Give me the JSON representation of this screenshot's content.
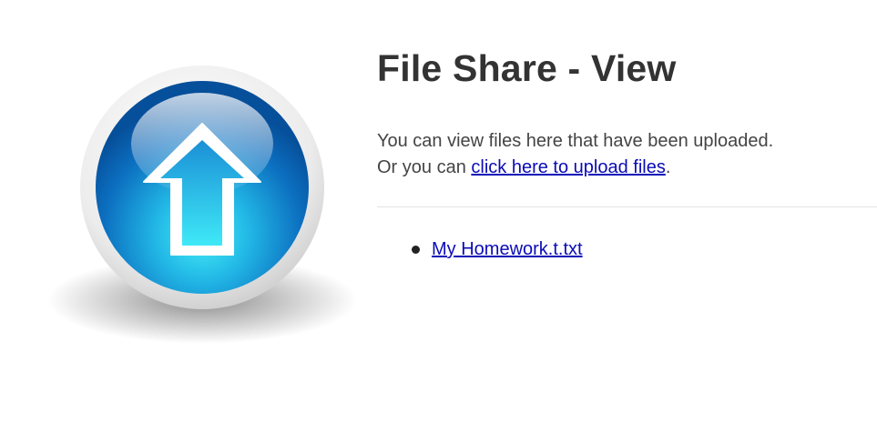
{
  "logo": {
    "icon": "upload-arrow-icon",
    "colors": {
      "orb_dark": "#0a5aa8",
      "orb_light": "#3fe6f5",
      "ring": "#e8e8e8"
    }
  },
  "page": {
    "title": "File Share - View",
    "intro_line1": "You can view files here that have been uploaded.",
    "intro_line2_prefix": "Or you can ",
    "upload_link_text": "click here to upload files",
    "intro_line2_suffix": "."
  },
  "files": [
    {
      "name": "My Homework.t.txt"
    }
  ],
  "colors": {
    "text": "#333333",
    "link": "#0b0bb8",
    "divider": "#e4e4e4"
  }
}
